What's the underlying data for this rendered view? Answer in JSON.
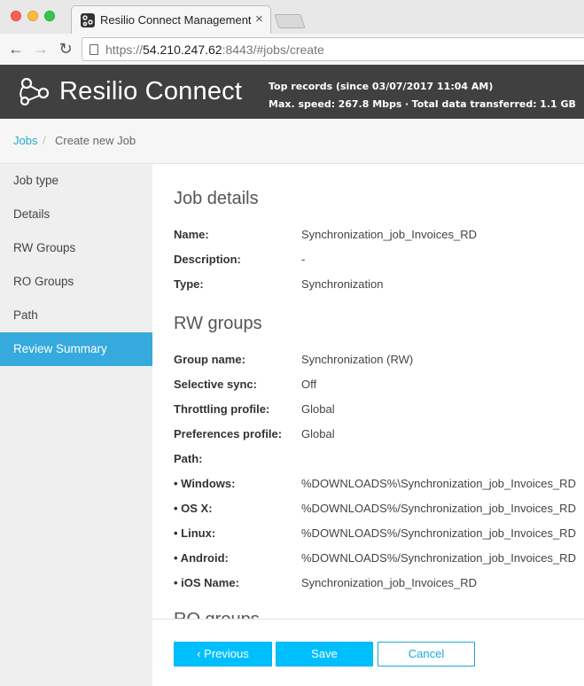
{
  "browser": {
    "tab_title": "Resilio Connect Management C",
    "tab_close": "×",
    "url_prefix": "https://",
    "url_host": "54.210.247.62",
    "url_rest": ":8443/#jobs/create",
    "back_glyph": "←",
    "forward_glyph": "→",
    "reload_glyph": "↻"
  },
  "header": {
    "brand": "Resilio Connect",
    "records_line": "Top records (since  03/07/2017 11:04 AM)",
    "max_speed_label": "Max. speed:",
    "max_speed_value": "267.8 Mbps",
    "separator": "·",
    "total_label": "Total data transferred:",
    "total_value": "1.1 GB"
  },
  "breadcrumb": {
    "root": "Jobs",
    "separator": "/",
    "current": "Create new Job"
  },
  "sidebar": {
    "items": [
      {
        "label": "Job type"
      },
      {
        "label": "Details"
      },
      {
        "label": "RW Groups"
      },
      {
        "label": "RO Groups"
      },
      {
        "label": "Path"
      },
      {
        "label": "Review Summary",
        "active": true
      }
    ]
  },
  "job_details": {
    "title": "Job details",
    "rows": [
      {
        "label": "Name:",
        "value": "Synchronization_job_Invoices_RD"
      },
      {
        "label": "Description:",
        "value": "-"
      },
      {
        "label": "Type:",
        "value": "Synchronization"
      }
    ]
  },
  "rw_groups": {
    "title": "RW groups",
    "rows": [
      {
        "label": "Group name:",
        "value": "Synchronization (RW)"
      },
      {
        "label": "Selective sync:",
        "value": "Off"
      },
      {
        "label": "Throttling profile:",
        "value": "Global"
      },
      {
        "label": "Preferences profile:",
        "value": "Global"
      },
      {
        "label": "Path:",
        "value": ""
      },
      {
        "label": "• Windows:",
        "value": "%DOWNLOADS%\\Synchronization_job_Invoices_RD"
      },
      {
        "label": "• OS X:",
        "value": "%DOWNLOADS%/Synchronization_job_Invoices_RD"
      },
      {
        "label": "• Linux:",
        "value": "%DOWNLOADS%/Synchronization_job_Invoices_RD"
      },
      {
        "label": "• Android:",
        "value": "%DOWNLOADS%/Synchronization_job_Invoices_RD"
      },
      {
        "label": "• iOS Name:",
        "value": "Synchronization_job_Invoices_RD"
      }
    ]
  },
  "ro_groups": {
    "title": "RO groups"
  },
  "footer": {
    "previous": "‹ Previous",
    "save": "Save",
    "cancel": "Cancel"
  },
  "colors": {
    "accent": "#00bfff",
    "active_sidebar": "#36a9dd",
    "header_bg": "#404040",
    "link": "#28a9d7"
  }
}
